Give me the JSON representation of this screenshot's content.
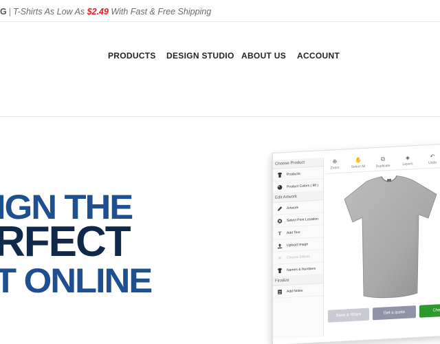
{
  "promo": {
    "lead": "G",
    "separator": "|",
    "text_before": "T-Shirts As Low As ",
    "price": "$2.49",
    "text_after": " With Fast & Free Shipping"
  },
  "nav": {
    "items": [
      "PRODUCTS",
      "DESIGN STUDIO",
      "ABOUT US",
      "ACCOUNT"
    ]
  },
  "hero": {
    "line1": "IGN THE",
    "line2": "RFECT",
    "line3": "T ONLINE"
  },
  "studio": {
    "sections": {
      "choose_product": "Choose Product",
      "edit_artwork": "Edit Artwork",
      "finalize": "Finalize"
    },
    "items": {
      "products": "Products",
      "product_colors": "Product Colors ( 98 )",
      "artwork": "Artwork",
      "select_print_location": "Select Print Location",
      "add_text": "Add Text",
      "upload_image": "Upload Image",
      "choose_effects": "Choose Effects",
      "names_numbers": "Names & Numbers",
      "add_notes": "Add Notes"
    },
    "toolbar": [
      "Zoom",
      "Select All",
      "Duplicate",
      "Layers",
      "Undo"
    ],
    "buttons": {
      "save_share": "Save & Share",
      "get_quote": "Get a quote",
      "checkout": "Che"
    },
    "shirt_color": "#a9a9a9"
  },
  "colors": {
    "price_red": "#e01b22",
    "hero_blue": "#1d4f91",
    "hero_navy": "#10294a",
    "checkout_green": "#2e9a2e"
  }
}
